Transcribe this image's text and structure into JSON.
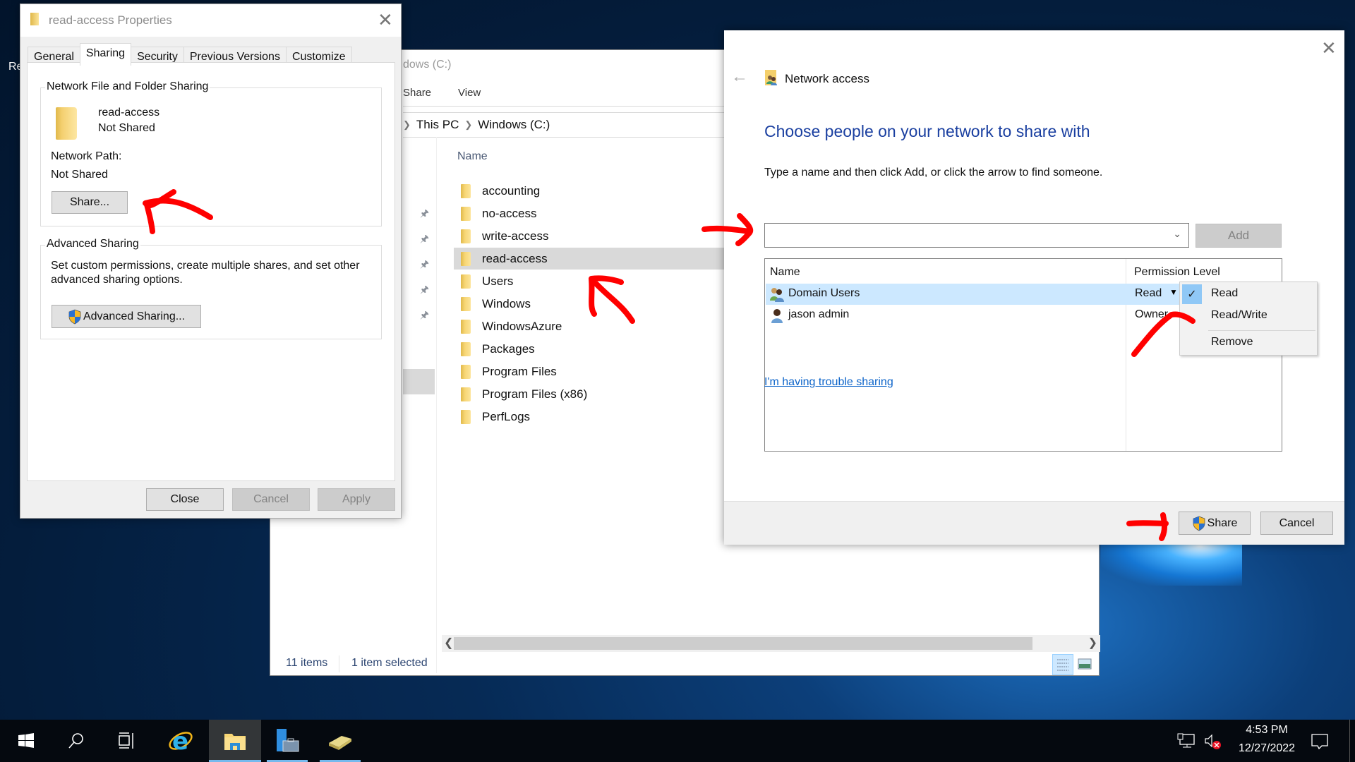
{
  "desktop": {
    "icon_label_fragment": "Re"
  },
  "explorer": {
    "title_fragment": "dows (C:)",
    "ribbon_tabs": [
      "Share",
      "View"
    ],
    "breadcrumb": [
      "This PC",
      "Windows (C:)"
    ],
    "column_header": "Name",
    "files": [
      {
        "name": "accounting",
        "selected": false
      },
      {
        "name": "no-access",
        "selected": false
      },
      {
        "name": "write-access",
        "selected": false
      },
      {
        "name": "read-access",
        "selected": true
      },
      {
        "name": "Users",
        "selected": false
      },
      {
        "name": "Windows",
        "selected": false
      },
      {
        "name": "WindowsAzure",
        "selected": false
      },
      {
        "name": "Packages",
        "selected": false
      },
      {
        "name": "Program Files",
        "selected": false
      },
      {
        "name": "Program Files (x86)",
        "selected": false
      },
      {
        "name": "PerfLogs",
        "selected": false
      }
    ],
    "status": {
      "item_count": "11 items",
      "selection": "1 item selected"
    }
  },
  "properties_dialog": {
    "title": "read-access Properties",
    "tabs": [
      "General",
      "Sharing",
      "Security",
      "Previous Versions",
      "Customize"
    ],
    "active_tab": "Sharing",
    "network_sharing": {
      "group_label": "Network File and Folder Sharing",
      "folder_name": "read-access",
      "folder_status": "Not Shared",
      "path_label": "Network Path:",
      "path_value": "Not Shared",
      "share_button": "Share..."
    },
    "advanced_sharing": {
      "group_label": "Advanced Sharing",
      "description_line1": "Set custom permissions, create multiple shares, and set other",
      "description_line2": "advanced sharing options.",
      "button": "Advanced Sharing..."
    },
    "buttons": {
      "close": "Close",
      "cancel": "Cancel",
      "apply": "Apply"
    }
  },
  "network_access_dialog": {
    "title": "Network access",
    "heading": "Choose people on your network to share with",
    "instruction": "Type a name and then click Add, or click the arrow to find someone.",
    "name_input_value": "",
    "add_button": "Add",
    "columns": {
      "name": "Name",
      "permission": "Permission Level"
    },
    "users": [
      {
        "name": "Domain Users",
        "permission": "Read",
        "selected": true
      },
      {
        "name": "jason admin",
        "permission": "Owner",
        "selected": false
      }
    ],
    "permission_menu": {
      "items": [
        "Read",
        "Read/Write",
        "Remove"
      ],
      "checked": "Read"
    },
    "trouble_link": "I'm having trouble sharing",
    "buttons": {
      "share": "Share",
      "cancel": "Cancel"
    }
  },
  "taskbar": {
    "apps": [
      "start",
      "search",
      "task-view",
      "internet-explorer",
      "file-explorer",
      "server-manager",
      "archive-app"
    ],
    "active_app": "file-explorer",
    "time": "4:53 PM",
    "date": "12/27/2022"
  },
  "colors": {
    "accent_heading": "#1a3fa0",
    "link": "#0b63c9",
    "selection": "#cce8ff",
    "annotation_red": "#ff0000"
  }
}
